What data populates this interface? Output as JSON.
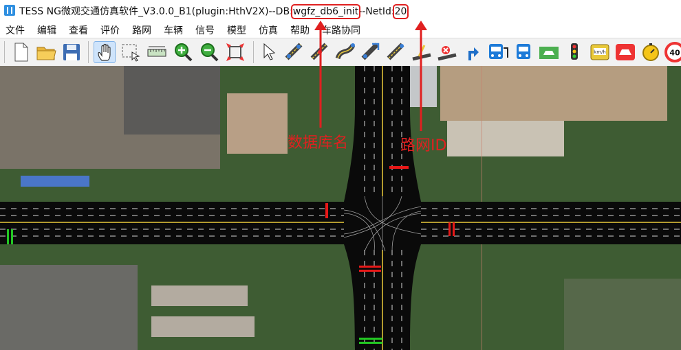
{
  "window": {
    "title_prefix": "TESS NG微观交通仿真软件_V3.0.0_B1(plugin:HthV2X)--DB:",
    "db_name": "wgfz_db6_init",
    "net_sep": "--NetId:",
    "net_id": "20"
  },
  "menu": [
    "文件",
    "编辑",
    "查看",
    "评价",
    "路网",
    "车辆",
    "信号",
    "模型",
    "仿真",
    "帮助",
    "车路协同"
  ],
  "toolbar": {
    "icons": [
      "new-file-icon",
      "open-folder-icon",
      "save-icon",
      "pan-hand-icon",
      "select-area-icon",
      "measure-ruler-icon",
      "zoom-in-icon",
      "zoom-out-icon",
      "fit-view-icon",
      "pointer-icon",
      "draw-link-icon",
      "edit-link-icon",
      "connect-link-icon",
      "link-flow-icon",
      "link-tool-icon",
      "lane-marker-icon",
      "remove-marker-icon",
      "direction-arrow-icon",
      "bus-line-icon",
      "bus-stop-icon",
      "parking-icon",
      "traffic-light-icon",
      "detector-icon",
      "collision-icon",
      "timer-icon",
      "speed-limit-icon"
    ],
    "speed_limit": "40"
  },
  "annotations": {
    "db_label": "数据库名",
    "net_label": "路网ID"
  },
  "colors": {
    "annotation_red": "#e02020",
    "signal_red": "#e81818",
    "signal_green": "#22c822",
    "road": "#0a0a0a"
  }
}
